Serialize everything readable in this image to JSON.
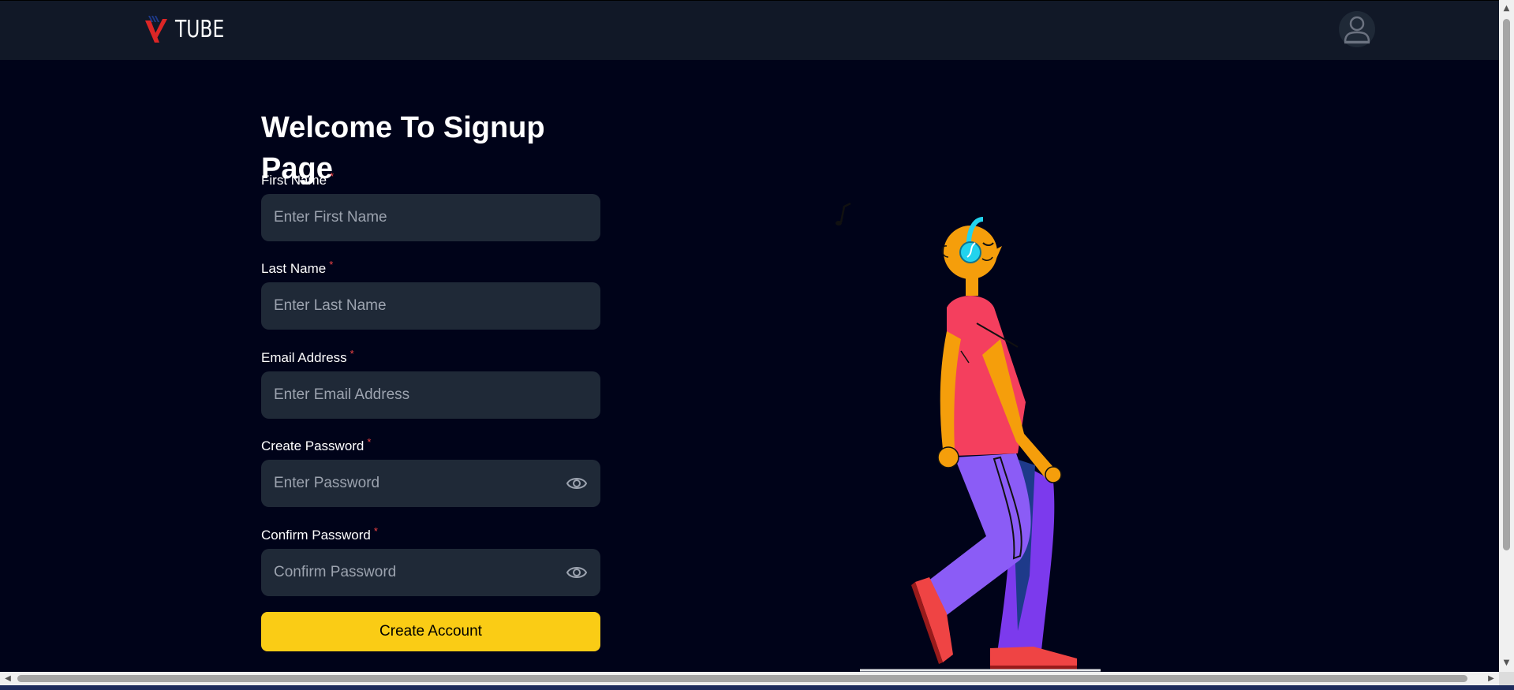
{
  "navbar": {
    "logo_text": "TUBE",
    "logo_icon": "v-logo-icon",
    "profile_icon": "user-avatar-icon"
  },
  "form": {
    "title": "Welcome To Signup Page",
    "required_marker": "*",
    "fields": [
      {
        "label": "First Name",
        "placeholder": "Enter First Name"
      },
      {
        "label": "Last Name",
        "placeholder": "Enter Last Name"
      },
      {
        "label": "Email Address",
        "placeholder": "Enter Email Address"
      },
      {
        "label": "Create Password",
        "placeholder": "Enter Password"
      },
      {
        "label": "Confirm Password",
        "placeholder": "Confirm Password"
      }
    ],
    "submit_label": "Create Account",
    "password_toggle_icon": "eye-icon"
  },
  "colors": {
    "background": "#000319",
    "navbar": "#111827",
    "input_bg": "#1f2937",
    "accent": "#facc15",
    "required": "#ef4444"
  }
}
